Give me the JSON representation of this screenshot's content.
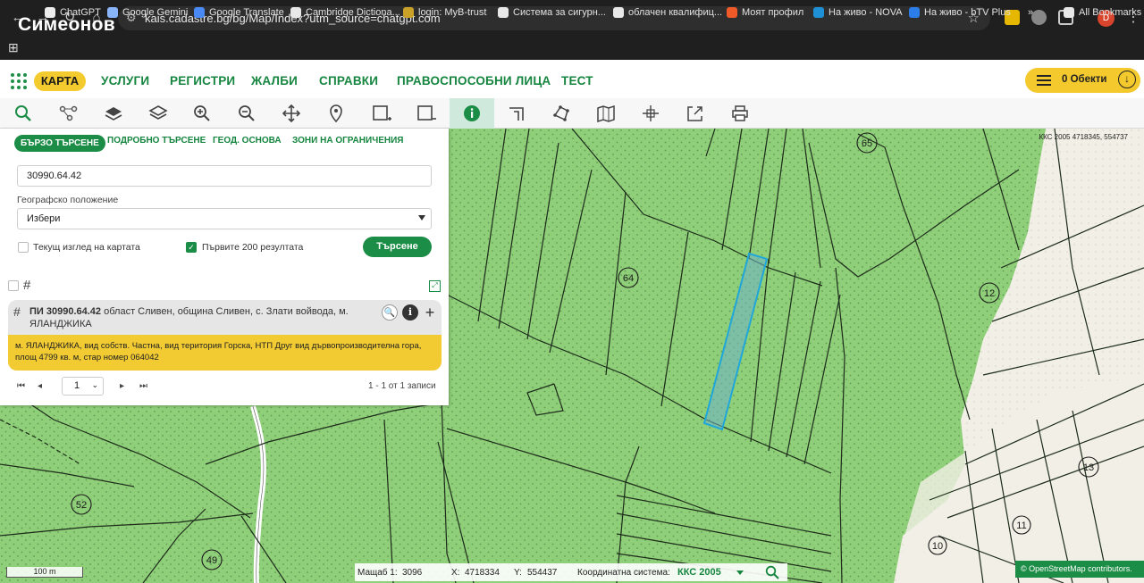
{
  "browser": {
    "url": "kais.cadastre.bg/bg/Map/Index?utm_source=chatgpt.com",
    "overlay_name": "Симеонов",
    "profile_initial": "D",
    "bookmarks": [
      {
        "label": "ChatGPT",
        "color": "#ececec"
      },
      {
        "label": "Google Gemini",
        "color": "#8ab4f8"
      },
      {
        "label": "Google Translate",
        "color": "#4a8af4"
      },
      {
        "label": "Cambridge Dictiona...",
        "color": "#e8e8e8"
      },
      {
        "label": "login: MyB-trust",
        "color": "#c9a227"
      },
      {
        "label": "Система за сигурн...",
        "color": "#e8e8e8"
      },
      {
        "label": "облачен квалифиц...",
        "color": "#e8e8e8"
      },
      {
        "label": "Моят профил",
        "color": "#f05a28"
      },
      {
        "label": "На живо - NOVA",
        "color": "#1e90d6"
      },
      {
        "label": "На живо - bTV Plus",
        "color": "#2b7de9"
      },
      {
        "label": "»",
        "color": ""
      },
      {
        "label": "All Bookmarks",
        "color": "#e8e8e8"
      }
    ]
  },
  "header": {
    "active": "КАРТА",
    "nav": [
      "УСЛУГИ",
      "РЕГИСТРИ",
      "ЖАЛБИ",
      "СПРАВКИ",
      "ПРАВОСПОСОБНИ ЛИЦА",
      "ТЕСТ"
    ],
    "objects_label": "0 Обекти"
  },
  "toolbar": {
    "tools": [
      "search-icon",
      "identify-icon",
      "layers-icon",
      "base-layers-icon",
      "zoom-in-icon",
      "zoom-out-icon",
      "pan-icon",
      "marker-icon",
      "select-area-icon",
      "select-clear-icon",
      "info-icon",
      "measure-icon",
      "polygon-icon",
      "map-icon",
      "crosshair-icon",
      "export-icon",
      "print-icon"
    ],
    "active_tool": "info-icon"
  },
  "panel": {
    "tabs": [
      "БЪРЗО ТЪРСЕНЕ",
      "ПОДРОБНО ТЪРСЕНЕ",
      "ГЕОД. ОСНОВА",
      "ЗОНИ НА ОГРАНИЧЕНИЯ"
    ],
    "search_value": "30990.64.42",
    "geo_label": "Географско положение",
    "geo_select": "Избери",
    "chk_current_view": "Текущ изглед на картата",
    "chk_first_200": "Първите 200 резултата",
    "search_button": "Търсене",
    "result_title_bold": "ПИ 30990.64.42",
    "result_title_rest": " област Сливен, община Сливен, с. Злати войвода, м. ЯЛАНДЖИКА",
    "result_body": "м. ЯЛАНДЖИКА, вид собств. Частна, вид територия Горска, НТП Друг вид дървопроизводителна гора, площ 4799 кв. м, стар номер 064042",
    "page_value": "1",
    "page_info": "1 - 1 от 1 записи"
  },
  "map": {
    "crs_corner": "ККС 2005 4718345, 554737",
    "block_labels": [
      "65",
      "64",
      "12",
      "13",
      "52",
      "49",
      "10",
      "11"
    ],
    "scale_label": "100 m",
    "scale_label_prefix": "Мащаб 1:",
    "scale_value": "3096",
    "x_label": "X:",
    "x_value": "4718334",
    "y_label": "Y:",
    "y_value": "554437",
    "crs_label": "Координатна система:",
    "crs_value": "ККС 2005",
    "attribution": "© OpenStreetMap contributors."
  },
  "colors": {
    "accent_green": "#1c8d46",
    "highlight_yellow": "#f3c92e",
    "forest": "#8fcf7a",
    "selected_parcel": "#6fb3c8"
  }
}
